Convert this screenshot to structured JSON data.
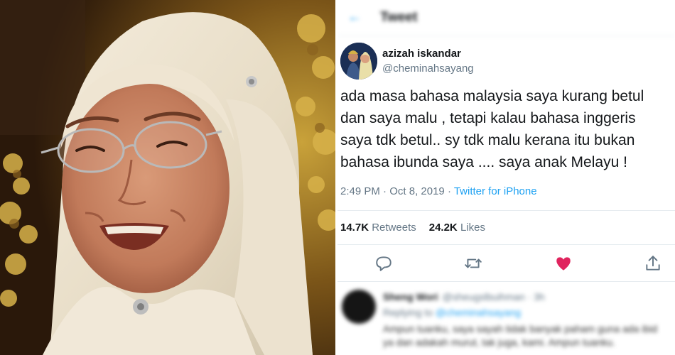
{
  "header": {
    "title": "Tweet",
    "back_icon": "arrow-left-icon"
  },
  "tweet": {
    "display_name": "azizah iskandar",
    "handle": "@cheminahsayang",
    "text": "ada masa bahasa malaysia saya kurang betul\ndan saya malu , tetapi kalau bahasa inggeris\nsaya tdk betul.. sy tdk malu kerana itu bukan\nbahasa ibunda saya .... saya anak Melayu !",
    "time": "2:49 PM",
    "separator": " · ",
    "date": "Oct 8, 2019",
    "source": "Twitter for iPhone",
    "retweets_count": "14.7K",
    "retweets_label": "Retweets",
    "likes_count": "24.2K",
    "likes_label": "Likes",
    "liked": true
  },
  "actions": [
    {
      "icon": "reply-icon"
    },
    {
      "icon": "retweet-icon"
    },
    {
      "icon": "heart-icon",
      "color": "#e0245e"
    },
    {
      "icon": "share-icon"
    }
  ],
  "reply": {
    "name": "Sheng Wori",
    "handle": "@sheugslbuihman · 3h",
    "replying_prefix": "Replying to",
    "replying_to": "@cheminahsayang",
    "text": "Ampun tuanku, saya sayah tidak banyak paham guna ada ibid ya dan adakah murut, tak juga, kami. Ampun tuanku."
  },
  "colors": {
    "accent": "#1da1f2",
    "like": "#e0245e",
    "muted": "#657786",
    "text": "#14171a"
  }
}
